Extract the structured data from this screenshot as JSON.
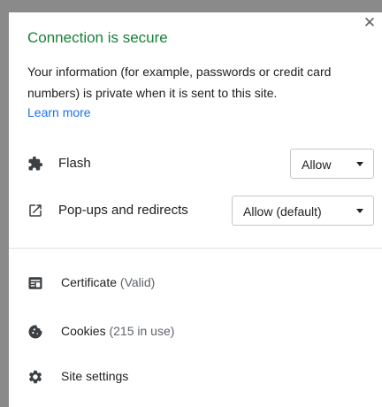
{
  "popup": {
    "close_icon": "✕",
    "title": "Connection is secure",
    "description": "Your information (for example, passwords or credit card numbers) is private when it is sent to this site.",
    "learn_more": "Learn more"
  },
  "permissions": [
    {
      "icon": "puzzle-icon",
      "label": "Flash",
      "value": "Allow"
    },
    {
      "icon": "open-external-icon",
      "label": "Pop-ups and redirects",
      "value": "Allow (default)"
    }
  ],
  "info": [
    {
      "icon": "certificate-icon",
      "label": "Certificate",
      "sub": "(Valid)"
    },
    {
      "icon": "cookie-icon",
      "label": "Cookies",
      "sub": "(215 in use)"
    },
    {
      "icon": "gear-icon",
      "label": "Site settings"
    }
  ],
  "colors": {
    "title_green": "#188038",
    "link_blue": "#1a73e8",
    "icon_gray": "#3c4043"
  }
}
